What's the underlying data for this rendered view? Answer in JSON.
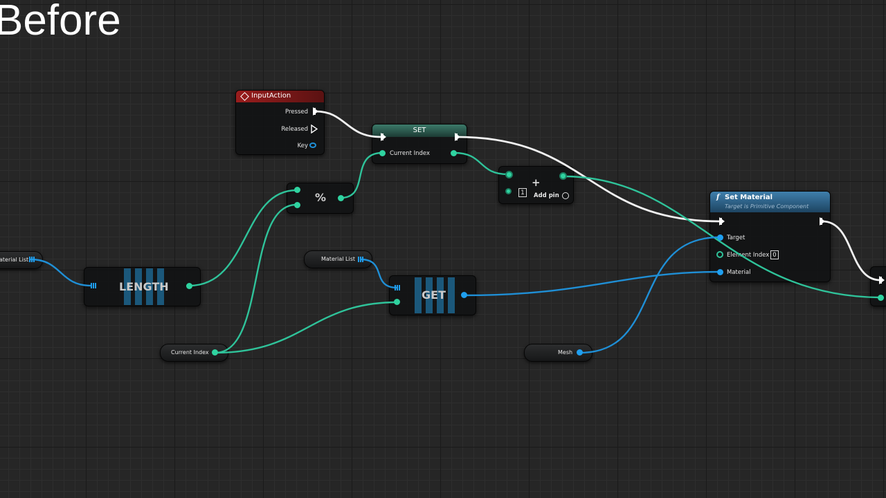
{
  "overlay_title": "Before",
  "colors": {
    "exec_wire": "#f2f2f2",
    "int_wire": "#2fc39a",
    "object_wire": "#1f8fd6",
    "input_action_header": "#8e1c1c",
    "set_header": "#2f5d52",
    "function_header": "#2b5f85"
  },
  "nodes": {
    "input_action": {
      "icon": "diamond-event-icon",
      "title": "InputAction",
      "pins": {
        "pressed": "Pressed",
        "released": "Released",
        "key": "Key"
      }
    },
    "set": {
      "title": "SET",
      "pin": "Current Index"
    },
    "modulo": {
      "symbol": "%"
    },
    "add": {
      "symbol": "+",
      "literal": "1",
      "add_pin": "Add pin"
    },
    "length": {
      "label": "LENGTH"
    },
    "get": {
      "label": "GET"
    },
    "set_material": {
      "icon": "function-icon",
      "title": "Set Material",
      "subtitle": "Target is Primitive Component",
      "pins": {
        "target": "Target",
        "element_index": "Element Index",
        "material": "Material"
      },
      "element_index_value": "0"
    }
  },
  "variables": {
    "material_list_left": "aterial List",
    "material_list": "Material List",
    "current_index": "Current Index",
    "mesh": "Mesh"
  }
}
